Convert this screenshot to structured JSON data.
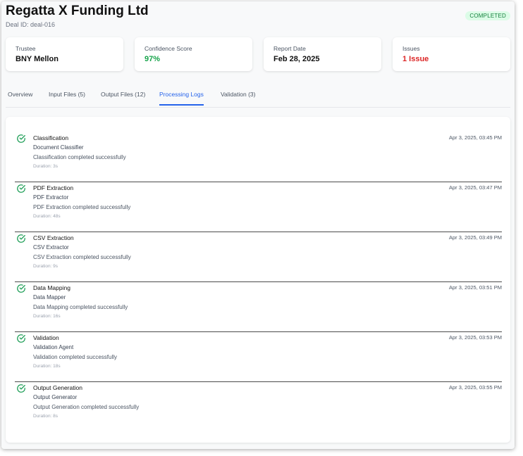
{
  "header": {
    "title": "Regatta X Funding Ltd",
    "deal_id": "Deal ID: deal-016",
    "status": "COMPLETED"
  },
  "cards": [
    {
      "label": "Trustee",
      "value": "BNY Mellon"
    },
    {
      "label": "Confidence Score",
      "value": "97%"
    },
    {
      "label": "Report Date",
      "value": "Feb 28, 2025"
    },
    {
      "label": "Issues",
      "value": "1 Issue"
    }
  ],
  "tabs": [
    {
      "label": "Overview"
    },
    {
      "label": "Input Files (5)"
    },
    {
      "label": "Output Files (12)"
    },
    {
      "label": "Processing Logs"
    },
    {
      "label": "Validation (3)"
    }
  ],
  "active_tab": "Processing Logs",
  "logs": [
    {
      "step": "Classification",
      "agent": "Document Classifier",
      "message": "Classification completed successfully",
      "duration": "Duration: 3s",
      "time": "Apr 3, 2025, 03:45 PM"
    },
    {
      "step": "PDF Extraction",
      "agent": "PDF Extractor",
      "message": "PDF Extraction completed successfully",
      "duration": "Duration: 48s",
      "time": "Apr 3, 2025, 03:47 PM"
    },
    {
      "step": "CSV Extraction",
      "agent": "CSV Extractor",
      "message": "CSV Extraction completed successfully",
      "duration": "Duration: 9s",
      "time": "Apr 3, 2025, 03:49 PM"
    },
    {
      "step": "Data Mapping",
      "agent": "Data Mapper",
      "message": "Data Mapping completed successfully",
      "duration": "Duration: 16s",
      "time": "Apr 3, 2025, 03:51 PM"
    },
    {
      "step": "Validation",
      "agent": "Validation Agent",
      "message": "Validation completed successfully",
      "duration": "Duration: 18s",
      "time": "Apr 3, 2025, 03:53 PM"
    },
    {
      "step": "Output Generation",
      "agent": "Output Generator",
      "message": "Output Generation completed successfully",
      "duration": "Duration: 8s",
      "time": "Apr 3, 2025, 03:55 PM"
    }
  ],
  "colors": {
    "success": "#22a05a",
    "accent": "#2563eb",
    "danger": "#dc2626",
    "badge_bg": "#dcfce7"
  },
  "icons": {
    "log_status": "check-circle-icon"
  }
}
